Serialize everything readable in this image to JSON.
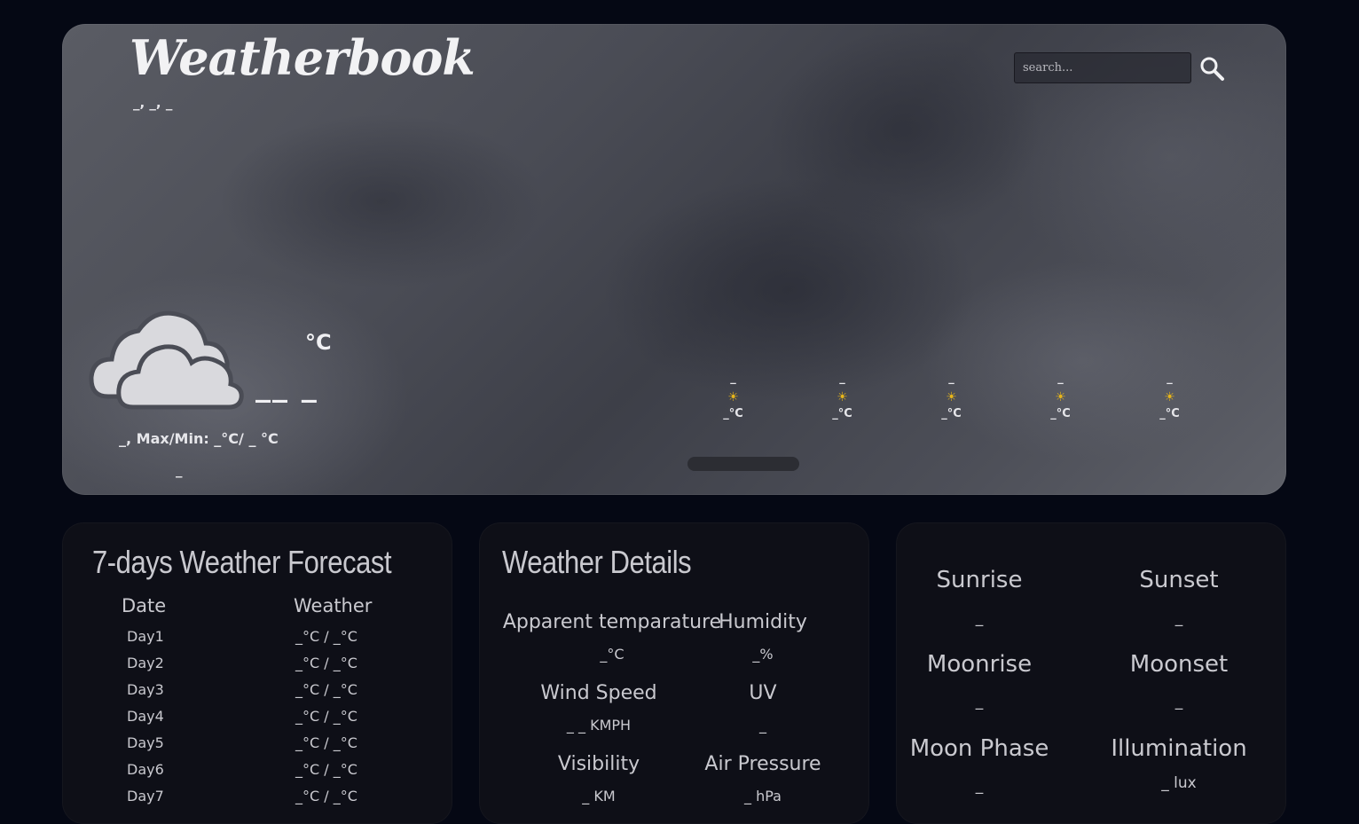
{
  "header": {
    "logo": "Weatherbook",
    "date_line": "_, _, _",
    "search": {
      "placeholder": "search..."
    }
  },
  "current": {
    "unit": "°C",
    "temp": "__ _",
    "condition_line": "_, Max/Min: _°C/ _ °C",
    "sub_line": "_"
  },
  "hourly": [
    {
      "time": "_",
      "icon": "sun-icon",
      "temp": "_°C"
    },
    {
      "time": "_",
      "icon": "sun-icon",
      "temp": "_°C"
    },
    {
      "time": "_",
      "icon": "sun-icon",
      "temp": "_°C"
    },
    {
      "time": "_",
      "icon": "sun-icon",
      "temp": "_°C"
    },
    {
      "time": "_",
      "icon": "sun-icon",
      "temp": "_°C"
    }
  ],
  "forecast": {
    "title": "7-days Weather Forecast",
    "col_date": "Date",
    "col_weather": "Weather",
    "rows": [
      {
        "date": "Day1",
        "weather": "_°C / _°C"
      },
      {
        "date": "Day2",
        "weather": "_°C / _°C"
      },
      {
        "date": "Day3",
        "weather": "_°C / _°C"
      },
      {
        "date": "Day4",
        "weather": "_°C / _°C"
      },
      {
        "date": "Day5",
        "weather": "_°C / _°C"
      },
      {
        "date": "Day6",
        "weather": "_°C / _°C"
      },
      {
        "date": "Day7",
        "weather": "_°C / _°C"
      }
    ]
  },
  "details": {
    "title": "Weather Details",
    "apparent_label": "Apparent temparature",
    "apparent_value": "_°C",
    "humidity_label": "Humidity",
    "humidity_value": "_%",
    "wind_label": "Wind Speed",
    "wind_value": "_ _ KMPH",
    "uv_label": "UV",
    "uv_value": "_",
    "visibility_label": "Visibility",
    "visibility_value": "_ KM",
    "pressure_label": "Air Pressure",
    "pressure_value": "_ hPa"
  },
  "astro": {
    "sunrise_label": "Sunrise",
    "sunrise_value": "_",
    "sunset_label": "Sunset",
    "sunset_value": "_",
    "moonrise_label": "Moonrise",
    "moonrise_value": "_",
    "moonset_label": "Moonset",
    "moonset_value": "_",
    "moonphase_label": "Moon Phase",
    "moonphase_value": "_",
    "illumination_label": "Illumination",
    "illumination_value": "_ lux"
  },
  "colors": {
    "sun": "#e7b51a",
    "card_bg": "#0e0f17",
    "page_bg": "#050814"
  }
}
